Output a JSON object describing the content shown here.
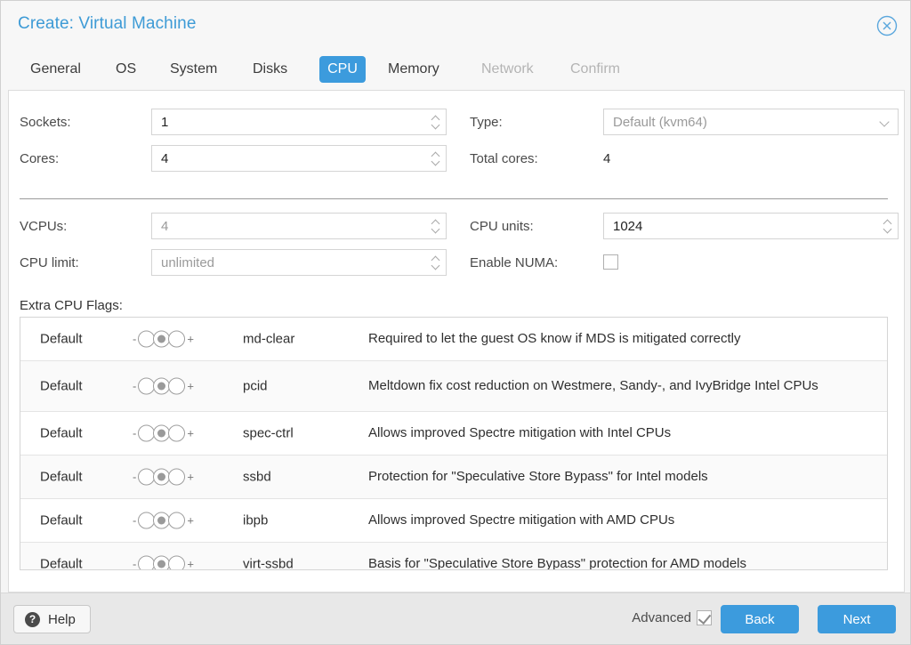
{
  "dialog": {
    "title": "Create: Virtual Machine",
    "close_icon": "close-circle-icon"
  },
  "tabs": [
    {
      "label": "General",
      "state": "normal"
    },
    {
      "label": "OS",
      "state": "normal"
    },
    {
      "label": "System",
      "state": "normal"
    },
    {
      "label": "Disks",
      "state": "normal"
    },
    {
      "label": "CPU",
      "state": "active"
    },
    {
      "label": "Memory",
      "state": "normal"
    },
    {
      "label": "Network",
      "state": "disabled"
    },
    {
      "label": "Confirm",
      "state": "disabled"
    }
  ],
  "form": {
    "sockets": {
      "label": "Sockets:",
      "value": "1"
    },
    "cores": {
      "label": "Cores:",
      "value": "4"
    },
    "type": {
      "label": "Type:",
      "value": "Default (kvm64)"
    },
    "total_cores": {
      "label": "Total cores:",
      "value": "4"
    },
    "vcpus": {
      "label": "VCPUs:",
      "value": "4"
    },
    "cpu_limit": {
      "label": "CPU limit:",
      "value": "unlimited"
    },
    "cpu_units": {
      "label": "CPU units:",
      "value": "1024"
    },
    "enable_numa": {
      "label": "Enable NUMA:",
      "checked": false
    }
  },
  "flags": {
    "label": "Extra CPU Flags:",
    "state_label": "Default",
    "minus": "-",
    "plus": "+",
    "rows": [
      {
        "state": "Default",
        "name": "md-clear",
        "desc": "Required to let the guest OS know if MDS is mitigated correctly"
      },
      {
        "state": "Default",
        "name": "pcid",
        "desc": "Meltdown fix cost reduction on Westmere, Sandy-, and IvyBridge Intel CPUs"
      },
      {
        "state": "Default",
        "name": "spec-ctrl",
        "desc": "Allows improved Spectre mitigation with Intel CPUs"
      },
      {
        "state": "Default",
        "name": "ssbd",
        "desc": "Protection for \"Speculative Store Bypass\" for Intel models"
      },
      {
        "state": "Default",
        "name": "ibpb",
        "desc": "Allows improved Spectre mitigation with AMD CPUs"
      },
      {
        "state": "Default",
        "name": "virt-ssbd",
        "desc": "Basis for \"Speculative Store Bypass\" protection for AMD models"
      }
    ]
  },
  "footer": {
    "help_label": "Help",
    "help_icon": "question-mark-icon",
    "advanced_label": "Advanced",
    "advanced_checked": true,
    "back_label": "Back",
    "next_label": "Next"
  },
  "colors": {
    "accent": "#3c9bdd",
    "title": "#3e9bd6",
    "panel": "#ffffff",
    "footer": "#e8e8e8"
  }
}
